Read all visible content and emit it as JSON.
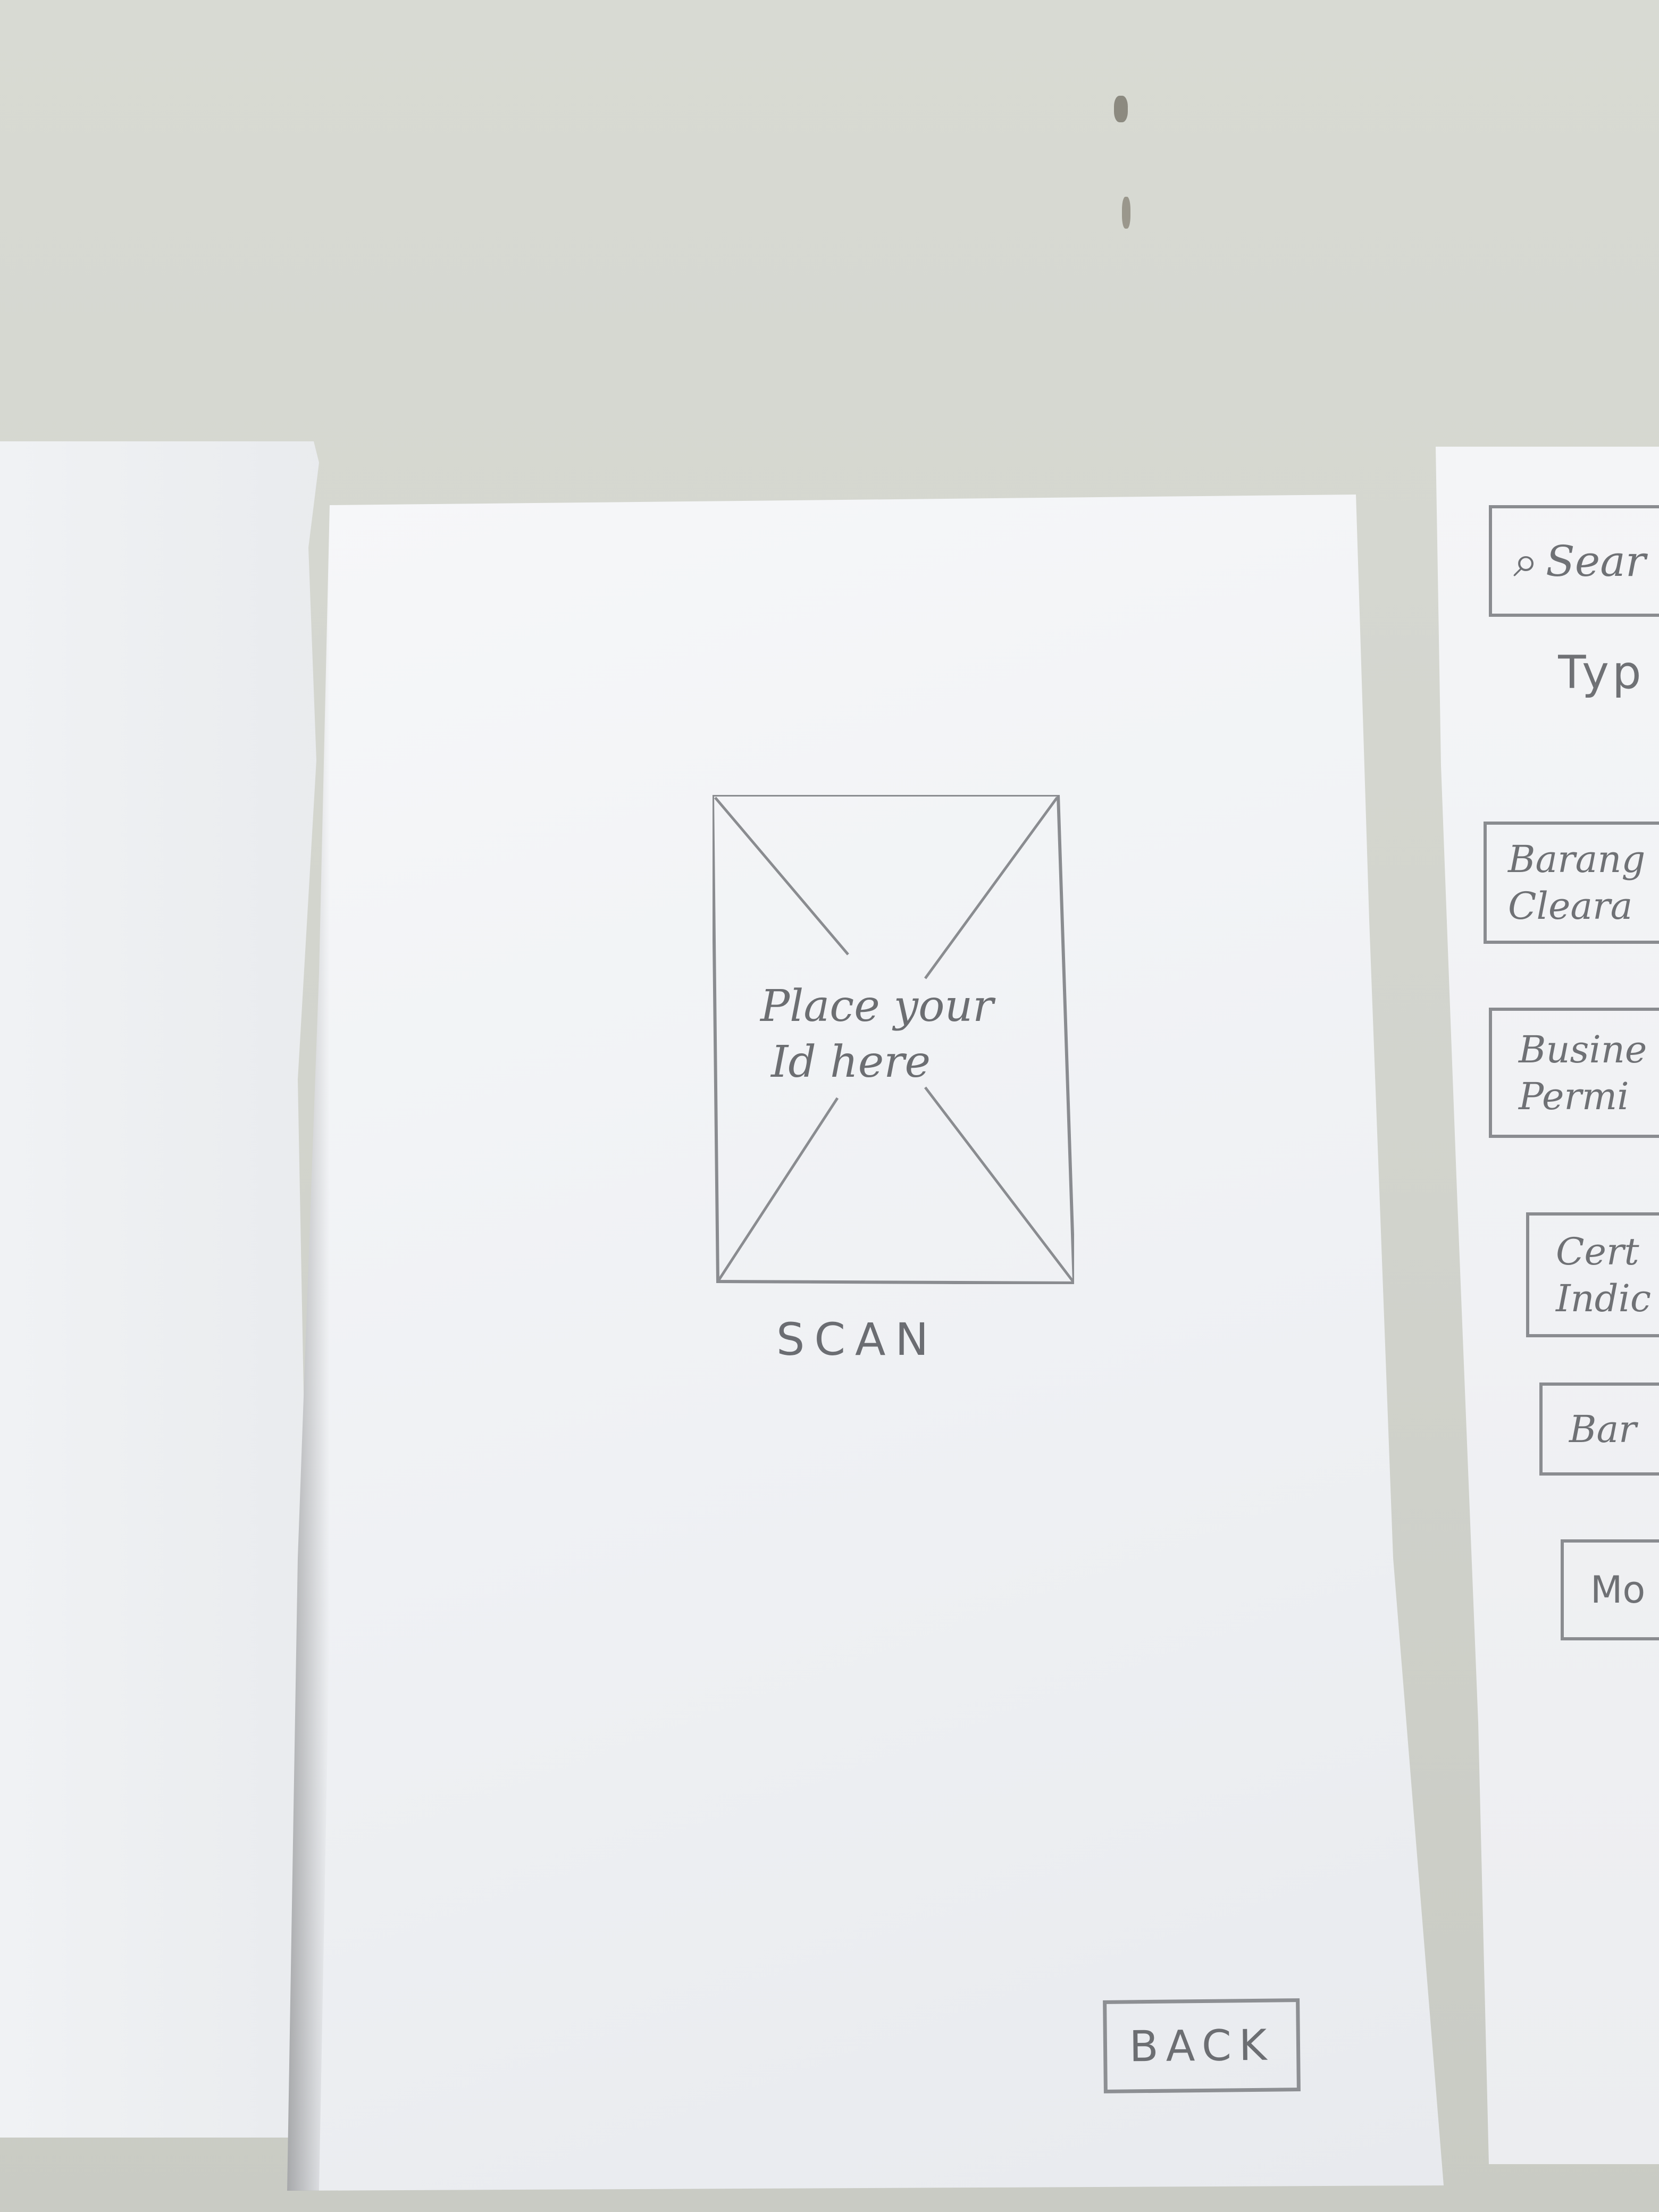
{
  "main_screen": {
    "id_placeholder": {
      "line1": "Place your",
      "line2": "Id here"
    },
    "scan_label": "SCAN",
    "back_label": "BACK"
  },
  "right_sheet": {
    "search_label": "Sear",
    "type_label": "Typ",
    "items": [
      {
        "line1": "Barang",
        "line2": "Cleara"
      },
      {
        "line1": "Busine",
        "line2": "Permi"
      },
      {
        "line1": "Cert",
        "line2": "Indic"
      },
      {
        "line1": "Bar",
        "line2": ""
      },
      {
        "line1": "Mo",
        "line2": ""
      }
    ]
  },
  "icons": {
    "search": "search-icon",
    "image_placeholder": "image-placeholder-icon"
  }
}
